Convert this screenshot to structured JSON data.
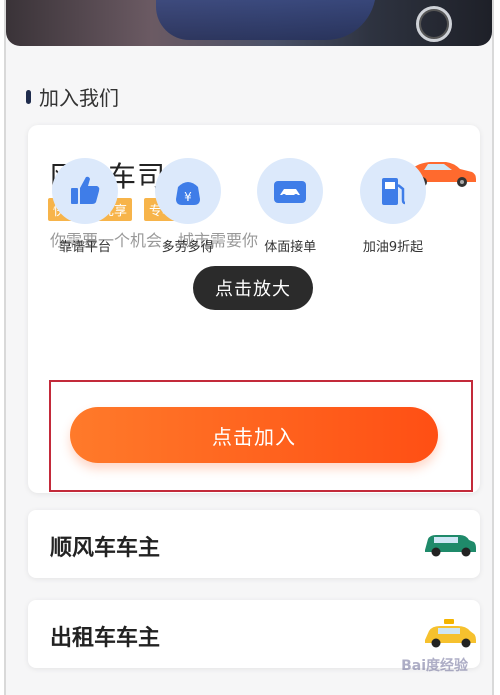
{
  "section": {
    "title": "加入我们"
  },
  "driver_card": {
    "title": "网约车司机",
    "tags": [
      "快车",
      "优享",
      "专车"
    ],
    "slogan": "你需要一个机会，城市需要你",
    "features": [
      {
        "icon": "thumbs-up-icon",
        "label": "靠谱平台"
      },
      {
        "icon": "yuan-money-icon",
        "label": "多劳多得"
      },
      {
        "icon": "car-icon",
        "label": "体面接单"
      },
      {
        "icon": "fuel-pump-icon",
        "label": "加油9折起"
      }
    ],
    "join_button": "点击加入"
  },
  "tooltip": "点击放大",
  "list": [
    {
      "title": "顺风车车主"
    },
    {
      "title": "出租车车主"
    }
  ],
  "watermark": "Bai度经验",
  "colors": {
    "accent": "#ff5f1f",
    "tag": "#f7b44a",
    "icon_bg": "#dce9fb",
    "icon_fg": "#3f7de8",
    "highlight": "#c32a3a"
  }
}
